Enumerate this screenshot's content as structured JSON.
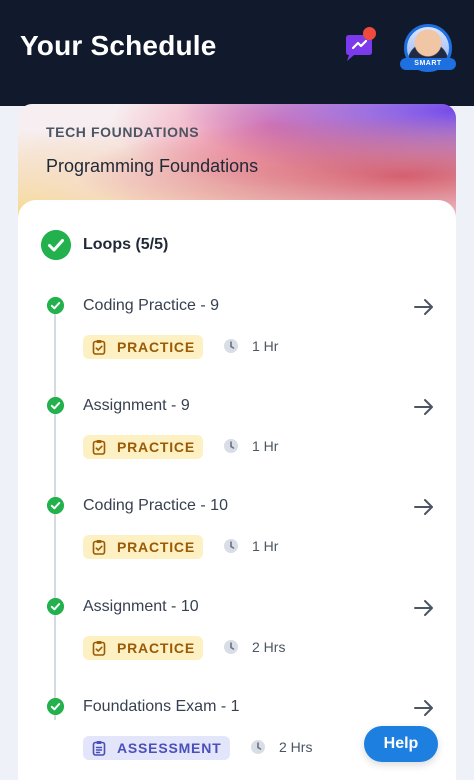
{
  "header": {
    "title": "Your Schedule",
    "avatar_badge": "SMART"
  },
  "course": {
    "subtitle": "TECH FOUNDATIONS",
    "name": "Programming Foundations"
  },
  "module": {
    "title": "Loops (5/5)"
  },
  "items": [
    {
      "title": "Coding Practice - 9",
      "tag": "PRACTICE",
      "duration": "1 Hr"
    },
    {
      "title": "Assignment - 9",
      "tag": "PRACTICE",
      "duration": "1 Hr"
    },
    {
      "title": "Coding Practice - 10",
      "tag": "PRACTICE",
      "duration": "1 Hr"
    },
    {
      "title": "Assignment - 10",
      "tag": "PRACTICE",
      "duration": "2 Hrs"
    },
    {
      "title": "Foundations Exam - 1",
      "tag": "ASSESSMENT",
      "duration": "2 Hrs"
    }
  ],
  "help_button": "Help",
  "colors": {
    "header_bg": "#111a2d",
    "success_green": "#22b14c",
    "practice_bg": "#fdf0c2",
    "practice_text": "#9a5a06",
    "assessment_bg": "#e3e5fb",
    "assessment_text": "#4b4fb8",
    "help_blue": "#1d7fe0",
    "notification_red": "#ef4b3c"
  }
}
